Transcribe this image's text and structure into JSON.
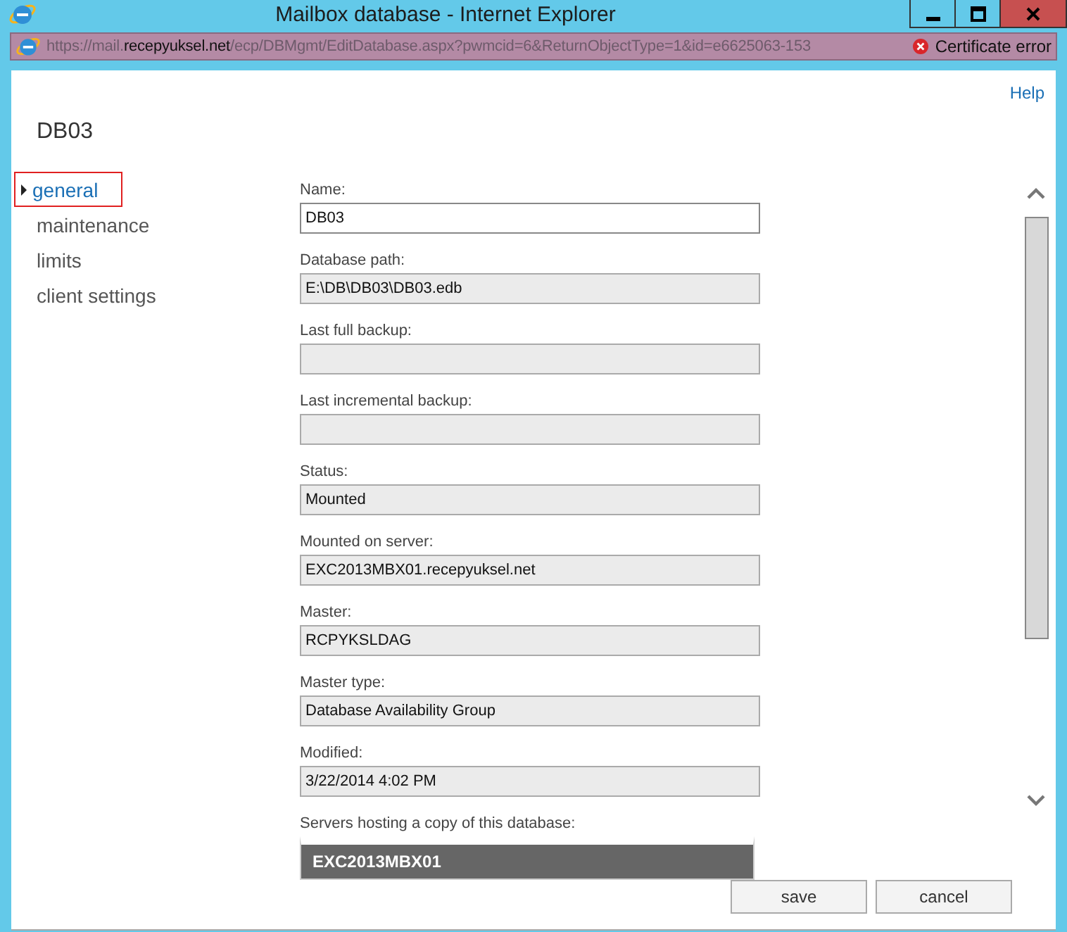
{
  "window": {
    "title": "Mailbox database - Internet Explorer"
  },
  "address_bar": {
    "url_start": "https://mail.",
    "url_host": "recepyuksel.net",
    "url_rest": "/ecp/DBMgmt/EditDatabase.aspx?pwmcid=6&ReturnObjectType=1&id=e6625063-153",
    "certificate": "Certificate error"
  },
  "help": "Help",
  "heading": "DB03",
  "nav": [
    {
      "label": "general",
      "selected": true
    },
    {
      "label": "maintenance",
      "selected": false
    },
    {
      "label": "limits",
      "selected": false
    },
    {
      "label": "client settings",
      "selected": false
    }
  ],
  "fields": [
    {
      "label": "Name:",
      "value": "DB03",
      "disabled": false
    },
    {
      "label": "Database path:",
      "value": "E:\\DB\\DB03\\DB03.edb",
      "disabled": true
    },
    {
      "label": "Last full backup:",
      "disabled": true
    },
    {
      "label": "Last incremental backup:",
      "disabled": true
    },
    {
      "label": "Status:",
      "value": "Mounted",
      "disabled": true
    },
    {
      "label": "Mounted on server:",
      "value": "EXC2013MBX01.recepyuksel.net",
      "disabled": true
    },
    {
      "label": "Master:",
      "value": "RCPYKSLDAG",
      "disabled": true
    },
    {
      "label": "Master type:",
      "value": "Database Availability Group",
      "disabled": true
    },
    {
      "label": "Modified:",
      "value": "3/22/2014 4:02 PM",
      "disabled": true
    }
  ],
  "servers": {
    "label": "Servers hosting a copy of this database:",
    "items": [
      {
        "name": "EXC2013MBX01",
        "selected": true
      }
    ]
  },
  "buttons": [
    "save",
    "cancel"
  ]
}
